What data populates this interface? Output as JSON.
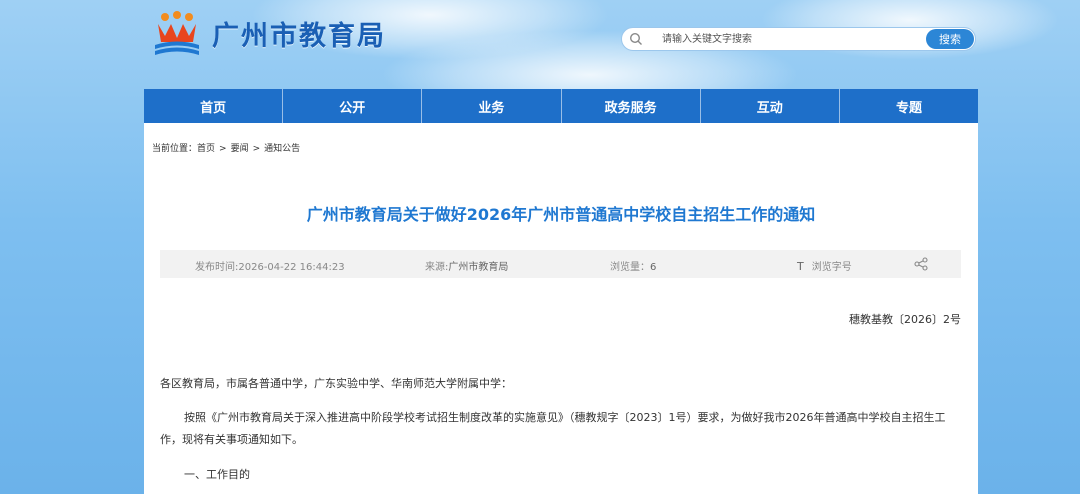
{
  "header": {
    "site_name": "广州市教育局",
    "search_placeholder": "请输入关键文字搜索",
    "search_button": "搜索"
  },
  "nav": {
    "items": [
      {
        "label": "首页"
      },
      {
        "label": "公开"
      },
      {
        "label": "业务"
      },
      {
        "label": "政务服务"
      },
      {
        "label": "互动"
      },
      {
        "label": "专题"
      }
    ]
  },
  "breadcrumb": {
    "prefix": "当前位置：",
    "items": [
      "首页",
      "要闻",
      "通知公告"
    ],
    "separator": ">"
  },
  "article": {
    "title": "广州市教育局关于做好2026年广州市普通高中学校自主招生工作的通知",
    "meta": {
      "publish_time": "发布时间:2026-04-22 16:44:23",
      "source_label": "来源:",
      "source_value": "广州市教育局",
      "views_label": "浏览量：",
      "views_value": "6",
      "font_icon_glyph": "T",
      "font_label": "浏览字号"
    },
    "doc_number": "穗教基教〔2026〕2号",
    "paragraphs": [
      "各区教育局，市属各普通中学，广东实验中学、华南师范大学附属中学：",
      "按照《广州市教育局关于深入推进高中阶段学校考试招生制度改革的实施意见》（穗教规字〔2023〕1号）要求，为做好我市2026年普通高中学校自主招生工作，现将有关事项通知如下。",
      "一、工作目的"
    ]
  },
  "colors": {
    "nav_bg": "#1e6fc9",
    "title": "#1f78d1",
    "site_name": "#1a5fb4",
    "search_button": "#2c86d6"
  },
  "icons": {
    "logo": "education-bureau-emblem",
    "search": "search-icon",
    "share": "share-icon"
  }
}
